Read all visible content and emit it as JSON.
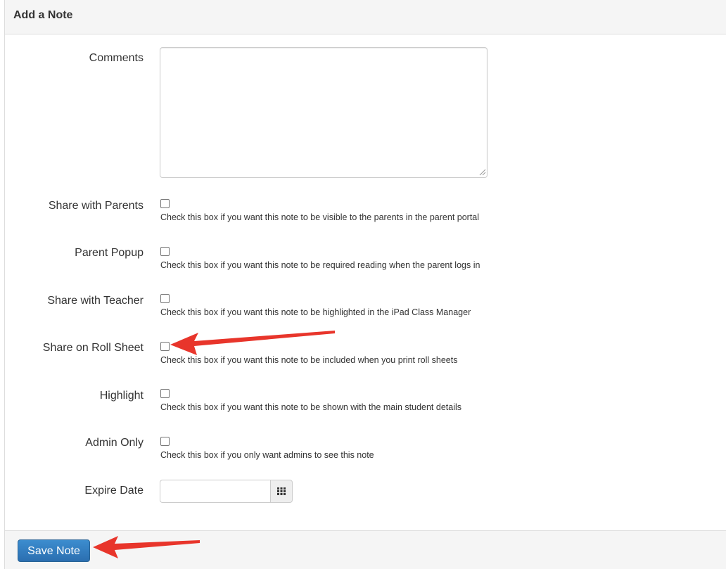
{
  "header": {
    "title": "Add a Note"
  },
  "form": {
    "comments": {
      "label": "Comments",
      "value": ""
    },
    "share_parents": {
      "label": "Share with Parents",
      "help": "Check this box if you want this note to be visible to the parents in the parent portal",
      "checked": false
    },
    "parent_popup": {
      "label": "Parent Popup",
      "help": "Check this box if you want this note to be required reading when the parent logs in",
      "checked": false
    },
    "share_teacher": {
      "label": "Share with Teacher",
      "help": "Check this box if you want this note to be highlighted in the iPad Class Manager",
      "checked": false
    },
    "share_roll_sheet": {
      "label": "Share on Roll Sheet",
      "help": "Check this box if you want this note to be included when you print roll sheets",
      "checked": false
    },
    "highlight": {
      "label": "Highlight",
      "help": "Check this box if you want this note to be shown with the main student details",
      "checked": false
    },
    "admin_only": {
      "label": "Admin Only",
      "help": "Check this box if you only want admins to see this note",
      "checked": false
    },
    "expire_date": {
      "label": "Expire Date",
      "value": "",
      "icon": "calendar-icon"
    }
  },
  "footer": {
    "save_label": "Save Note"
  },
  "colors": {
    "primary": "#337ab7",
    "annotation_arrow": "#e8352b",
    "panel_bg": "#f5f5f5"
  }
}
